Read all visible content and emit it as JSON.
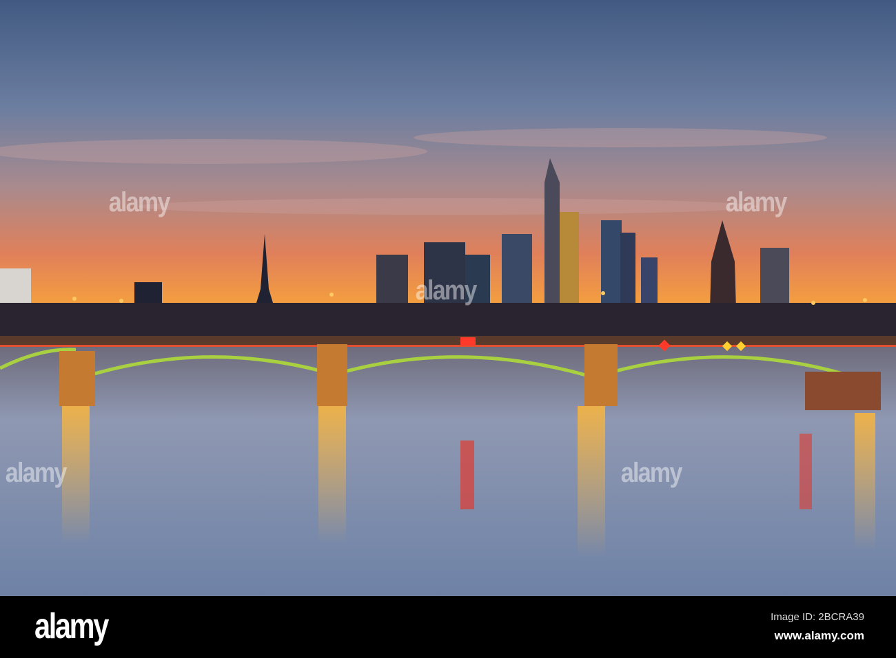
{
  "photo": {
    "subject": "Frankfurt skyline at dusk with illuminated bridge over the river"
  },
  "watermark": {
    "text": "alamy"
  },
  "footer": {
    "logo": "alamy",
    "image_id": "Image ID: 2BCRA39",
    "website": "www.alamy.com"
  },
  "colors": {
    "sky_top": "#4a5f86",
    "sunset": "#f08a3a",
    "water": "#7c8aa8",
    "bridge_light": "#9acb3a"
  }
}
